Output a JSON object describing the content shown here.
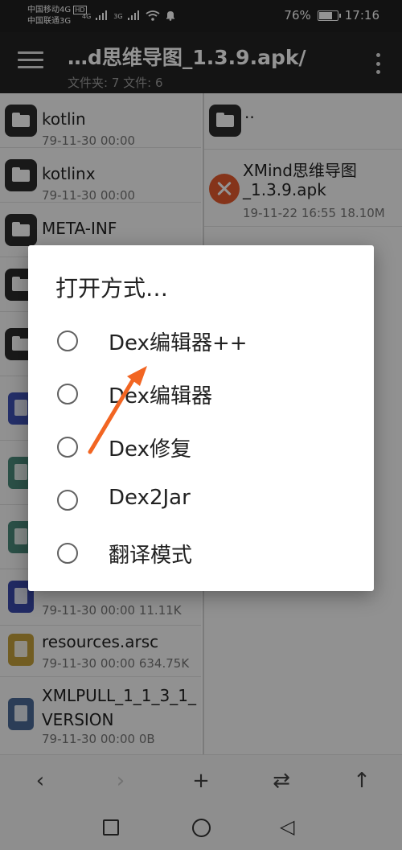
{
  "status_bar": {
    "carrier1": "中国移动4G",
    "carrier1_badge": "HD",
    "carrier2": "中国联通3G",
    "signal_left": "4G",
    "signal_right": "3G",
    "battery": "76%",
    "battery_level": 0.76,
    "time": "17:16"
  },
  "toolbar": {
    "title": "…d思维导图_1.3.9.apk/",
    "subtitle": "文件夹: 7  文件: 6"
  },
  "left_pane": {
    "items": [
      {
        "name": "kotlin",
        "meta": "79-11-30 00:00",
        "icon": "folder-icon"
      },
      {
        "name": "kotlinx",
        "meta": "79-11-30 00:00",
        "icon": "folder-icon"
      },
      {
        "name": "META-INF",
        "meta": "",
        "icon": "folder-icon"
      },
      {
        "name": "",
        "meta": "",
        "icon": "folder-icon"
      },
      {
        "name": "",
        "meta": "",
        "icon": "folder-icon"
      },
      {
        "name": "",
        "meta": "",
        "icon": "code-file-icon"
      },
      {
        "name": "",
        "meta": "",
        "icon": "dex-file-icon"
      },
      {
        "name": "",
        "meta": "",
        "icon": "dex-file-icon"
      },
      {
        "name": "",
        "meta": "79-11-30 00:00  11.11K",
        "icon": "text-file-icon"
      },
      {
        "name": "resources.arsc",
        "meta": "79-11-30 00:00  634.75K",
        "icon": "resources-file-icon"
      },
      {
        "name": "XMLPULL_1_1_3_1_VERSION",
        "meta": "79-11-30 00:00  0B",
        "icon": "generic-file-icon"
      }
    ]
  },
  "right_pane": {
    "parent": "..",
    "apk": {
      "name_line1": "XMind思维导图",
      "name_line2": "_1.3.9.apk",
      "meta": "19-11-22 16:55  18.10M"
    }
  },
  "dialog": {
    "title": "打开方式…",
    "options": [
      "Dex编辑器++",
      "Dex编辑器",
      "Dex修复",
      "Dex2Jar",
      "翻译模式"
    ]
  },
  "bottom_bar": {
    "back": "‹",
    "forward": "›",
    "add": "+",
    "swap": "⇄",
    "up": "↑"
  },
  "nav": {
    "back": "◁"
  },
  "colors": {
    "toolbar": "#242424",
    "annotation_arrow": "#f26522",
    "apk_icon": "#e65a2e",
    "code_file": "#3f51b5",
    "dex_file": "#4a8a7a",
    "text_file": "#3949ab",
    "resources_file": "#c5a03c"
  }
}
